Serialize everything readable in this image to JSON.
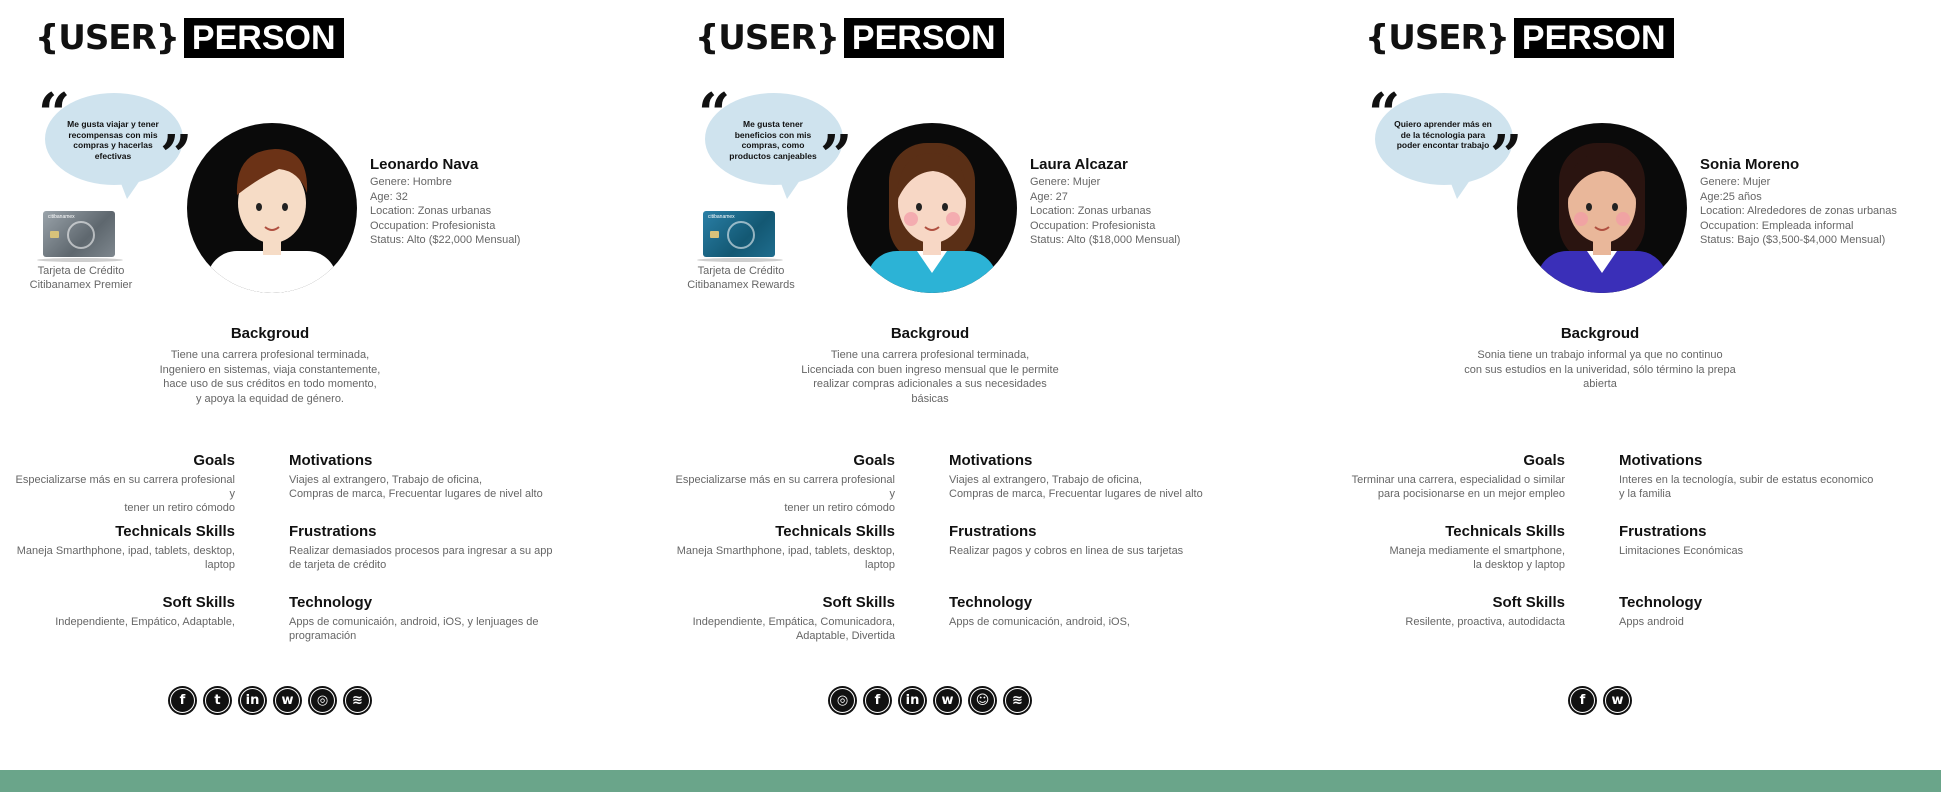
{
  "title": {
    "brace": "{USER}",
    "label": "PERSON"
  },
  "colors": {
    "footer": "#6aa58a",
    "bubble": "#cfe3ee"
  },
  "labels": {
    "background": "Backgroud",
    "goals": "Goals",
    "motivations": "Motivations",
    "technical": "Technicals Skills",
    "frustrations": "Frustrations",
    "soft": "Soft Skills",
    "technology": "Technology"
  },
  "personas": [
    {
      "quote": "Me gusta viajar y tener recompensas con mis compras y hacerlas efectivas",
      "card": {
        "caption_line1": "Tarjeta de Crédito",
        "caption_line2": "Citibanamex Premier",
        "color": "gray"
      },
      "name": "Leonardo Nava",
      "details": [
        "Genere: Hombre",
        "Age: 32",
        "Location: Zonas urbanas",
        "Occupation: Profesionista",
        "Status: Alto ($22,000 Mensual)"
      ],
      "background": [
        "Tiene una carrera profesional terminada,",
        "Ingeniero en sistemas, viaja constantemente,",
        "hace uso de sus créditos en todo momento,",
        "y apoya la equidad de género."
      ],
      "goals": [
        "Especializarse más en su carrera profesional y",
        "tener un retiro  cómodo"
      ],
      "motivations": [
        "Viajes al extrangero, Trabajo de oficina,",
        "Compras de marca, Frecuentar lugares de nivel alto"
      ],
      "technical": [
        "Maneja Smarthphone, ipad, tablets, desktop,",
        "laptop"
      ],
      "frustrations": [
        "Realizar demasiados procesos para ingresar a su app",
        "de tarjeta de crédito"
      ],
      "soft": [
        "Independiente, Empático, Adaptable,"
      ],
      "technology": [
        "Apps de comunicaión, android, iOS, y lenjuages de",
        "programación"
      ],
      "social": [
        "facebook-icon",
        "twitter-icon",
        "linkedin-icon",
        "whatsapp-icon",
        "instagram-icon",
        "spotify-icon"
      ]
    },
    {
      "quote": "Me gusta tener beneficios con mis compras, como productos canjeables",
      "card": {
        "caption_line1": "Tarjeta de Crédito",
        "caption_line2": "Citibanamex Rewards",
        "color": "blue"
      },
      "name": "Laura Alcazar",
      "details": [
        "Genere: Mujer",
        "Age: 27",
        "Location: Zonas urbanas",
        "Occupation: Profesionista",
        "Status: Alto ($18,000 Mensual)"
      ],
      "background": [
        "Tiene una carrera profesional terminada,",
        "Licenciada con buen ingreso mensual que le permite",
        "realizar compras adicionales a sus necesidades",
        "básicas"
      ],
      "goals": [
        "Especializarse más en su carrera profesional y",
        "tener un retiro  cómodo"
      ],
      "motivations": [
        "Viajes al extrangero, Trabajo de oficina,",
        "Compras de marca, Frecuentar lugares de nivel alto"
      ],
      "technical": [
        "Maneja Smarthphone, ipad, tablets, desktop,",
        "laptop"
      ],
      "frustrations": [
        "Realizar pagos  y cobros en linea de sus tarjetas"
      ],
      "soft": [
        "Independiente, Empática, Comunicadora,",
        "Adaptable, Divertida"
      ],
      "technology": [
        "Apps de comunicación, android, iOS,"
      ],
      "social": [
        "instagram-icon",
        "facebook-icon",
        "linkedin-icon",
        "whatsapp-icon",
        "snapchat-icon",
        "spotify-icon"
      ]
    },
    {
      "quote": "Quiero aprender más en de la técnologia para poder encontar trabajo",
      "card": null,
      "name": "Sonia Moreno",
      "details": [
        "Genere: Mujer",
        "Age:25 años",
        "Location: Alrededores de zonas urbanas",
        "Occupation: Empleada informal",
        "Status: Bajo ($3,500-$4,000 Mensual)"
      ],
      "background": [
        "Sonia tiene un trabajo informal ya que no continuo",
        "con sus estudios en la univeridad, sólo término la prepa abierta"
      ],
      "goals": [
        "Terminar una carrera, especialidad o similar",
        "para pocisionarse en un mejor empleo"
      ],
      "motivations": [
        "Interes en la tecnología, subir de estatus economico",
        "y la familia"
      ],
      "technical": [
        "Maneja mediamente el smartphone,",
        "la desktop y laptop"
      ],
      "frustrations": [
        "Limitaciones Económicas"
      ],
      "soft": [
        "Resilente, proactiva, autodidacta"
      ],
      "technology": [
        "Apps android"
      ],
      "social": [
        "facebook-icon",
        "whatsapp-icon"
      ]
    }
  ]
}
